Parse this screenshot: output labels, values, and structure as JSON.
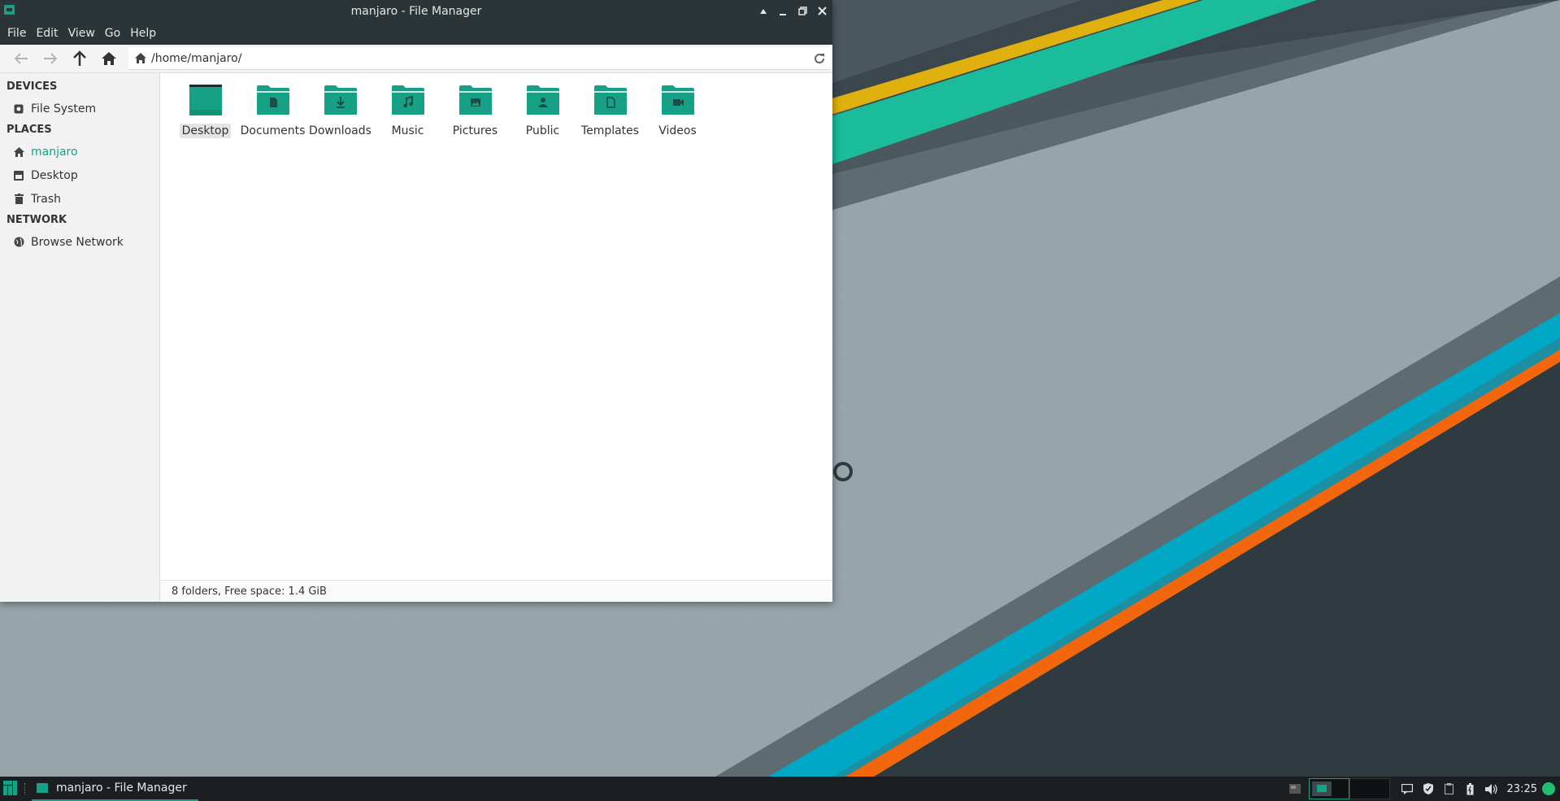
{
  "window": {
    "title": "manjaro - File Manager",
    "menu": [
      "File",
      "Edit",
      "View",
      "Go",
      "Help"
    ]
  },
  "toolbar": {
    "path": "/home/manjaro/"
  },
  "sidebar": {
    "devices_heading": "DEVICES",
    "devices": [
      {
        "label": "File System",
        "icon": "drive-icon"
      }
    ],
    "places_heading": "PLACES",
    "places": [
      {
        "label": "manjaro",
        "icon": "home-icon",
        "active": true
      },
      {
        "label": "Desktop",
        "icon": "desktop-icon"
      },
      {
        "label": "Trash",
        "icon": "trash-icon"
      }
    ],
    "network_heading": "NETWORK",
    "network": [
      {
        "label": "Browse Network",
        "icon": "globe-icon"
      }
    ]
  },
  "files": [
    {
      "name": "Desktop",
      "glyph": "desktop",
      "selected": true
    },
    {
      "name": "Documents",
      "glyph": "document"
    },
    {
      "name": "Downloads",
      "glyph": "download"
    },
    {
      "name": "Music",
      "glyph": "music"
    },
    {
      "name": "Pictures",
      "glyph": "picture"
    },
    {
      "name": "Public",
      "glyph": "person"
    },
    {
      "name": "Templates",
      "glyph": "template"
    },
    {
      "name": "Videos",
      "glyph": "video"
    }
  ],
  "status": "8 folders, Free space: 1.4 GiB",
  "taskbar": {
    "task_label": "manjaro - File Manager",
    "clock": "23:25"
  },
  "colors": {
    "accent": "#16a085",
    "titlebar": "#2b3538",
    "wallpaper_yellow": "#e0b00e",
    "wallpaper_teal": "#1abc9c",
    "wallpaper_cyan": "#00a8c6",
    "wallpaper_orange": "#f2660d"
  }
}
